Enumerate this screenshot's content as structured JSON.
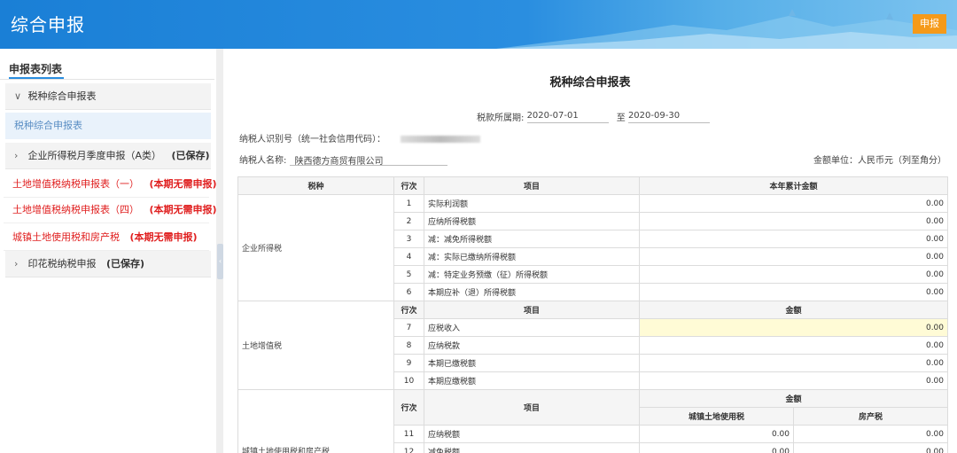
{
  "header": {
    "title": "综合申报",
    "submit_label": "申报"
  },
  "sidebar": {
    "list_title": "申报表列表",
    "items": [
      {
        "label": "税种综合申报表",
        "type": "group",
        "chevron": "∨",
        "status": ""
      },
      {
        "label": "税种综合申报表",
        "type": "active",
        "chevron": "",
        "status": ""
      },
      {
        "label": "企业所得税月季度申报（A类）",
        "type": "group",
        "chevron": "›",
        "status": "(已保存)"
      },
      {
        "label": "土地增值税纳税申报表（一）",
        "type": "red",
        "chevron": "",
        "status": "(本期无需申报)"
      },
      {
        "label": "土地增值税纳税申报表（四）",
        "type": "red",
        "chevron": "",
        "status": "(本期无需申报)"
      },
      {
        "label": "城镇土地使用税和房产税",
        "type": "red",
        "chevron": "",
        "status": "(本期无需申报)"
      },
      {
        "label": "印花税纳税申报",
        "type": "group",
        "chevron": "›",
        "status": "(已保存)"
      }
    ]
  },
  "form": {
    "title": "税种综合申报表",
    "period_label": "税款所属期:",
    "period_from": "2020-07-01",
    "period_to_label": "至",
    "period_to": "2020-09-30",
    "taxpayer_id_label": "纳税人识别号（统一社会信用代码）：",
    "taxpayer_name_label": "纳税人名称:",
    "taxpayer_name": "陕西德方商贸有限公司",
    "unit_note": "金额单位：人民币元（列至角分）",
    "headers": {
      "tax": "税种",
      "line": "行次",
      "item": "项目",
      "ytd": "本年累计金额",
      "amount": "金额",
      "land_use": "城镇土地使用税",
      "property": "房产税"
    },
    "cit": {
      "name": "企业所得税",
      "rows": [
        {
          "no": "1",
          "item": "实际利润额",
          "value": "0.00"
        },
        {
          "no": "2",
          "item": "应纳所得税额",
          "value": "0.00"
        },
        {
          "no": "3",
          "item": "减：减免所得税额",
          "value": "0.00"
        },
        {
          "no": "4",
          "item": "减：实际已缴纳所得税额",
          "value": "0.00"
        },
        {
          "no": "5",
          "item": "减：特定业务预缴（征）所得税额",
          "value": "0.00"
        },
        {
          "no": "6",
          "item": "本期应补（退）所得税额",
          "value": "0.00"
        }
      ]
    },
    "lat": {
      "name": "土地增值税",
      "rows": [
        {
          "no": "7",
          "item": "应税收入",
          "value": "0.00"
        },
        {
          "no": "8",
          "item": "应纳税款",
          "value": "0.00"
        },
        {
          "no": "9",
          "item": "本期已缴税额",
          "value": "0.00"
        },
        {
          "no": "10",
          "item": "本期应缴税额",
          "value": "0.00"
        }
      ]
    },
    "ulpt": {
      "name": "城镇土地使用税和房产税",
      "rows": [
        {
          "no": "11",
          "item": "应纳税额",
          "land": "0.00",
          "prop": "0.00"
        },
        {
          "no": "12",
          "item": "减免税额",
          "land": "0.00",
          "prop": "0.00"
        }
      ]
    }
  }
}
